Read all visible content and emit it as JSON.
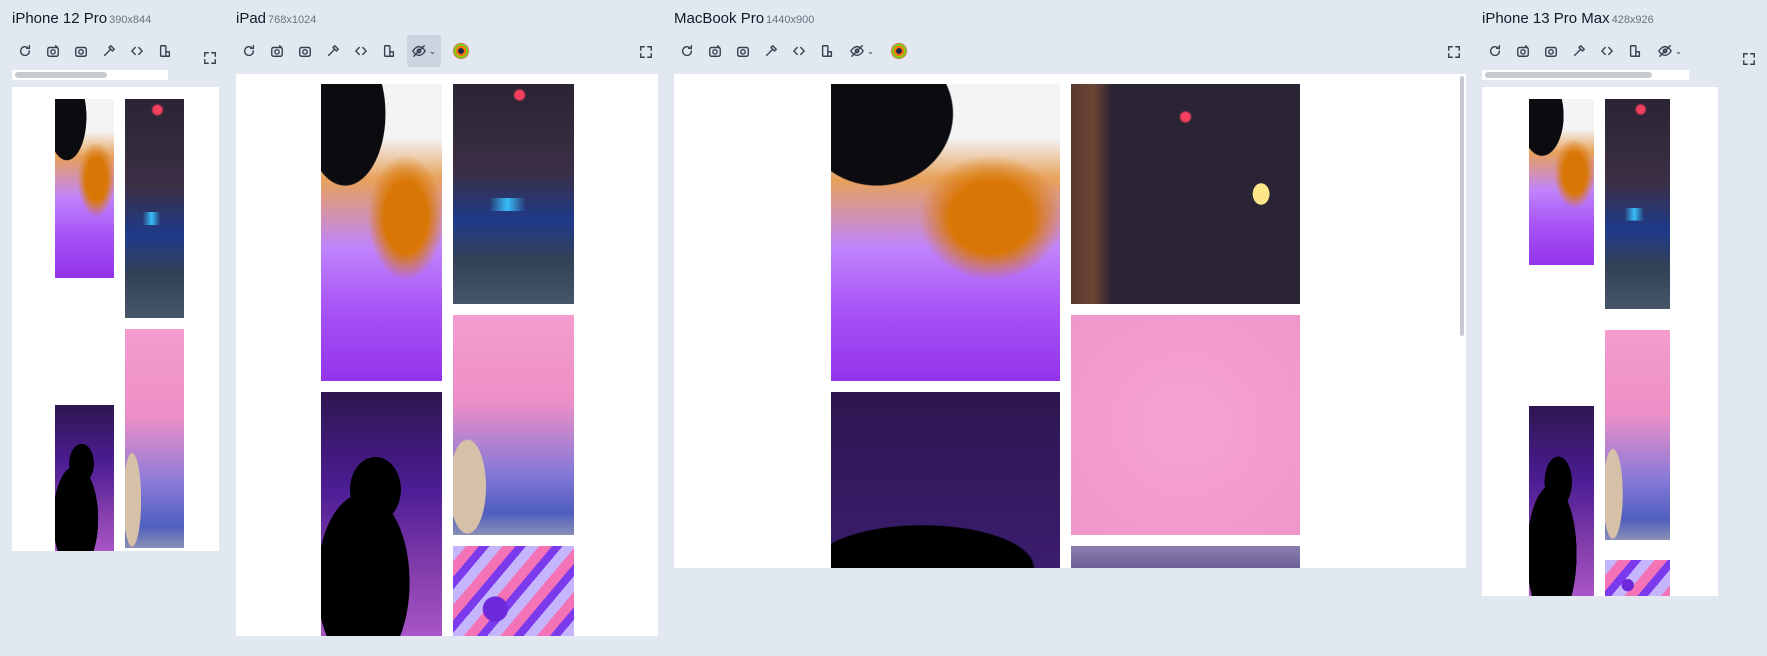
{
  "devices": [
    {
      "name": "iPhone 12 Pro",
      "size": "390x844"
    },
    {
      "name": "iPad",
      "size": "768x1024"
    },
    {
      "name": "MacBook Pro",
      "size": "1440x900"
    },
    {
      "name": "iPhone 13 Pro Max",
      "size": "428x926"
    }
  ],
  "toolbar_icons": [
    "refresh-icon",
    "screenshot-full-icon",
    "camera-icon",
    "eyedropper-icon",
    "code-icon",
    "rotate-device-icon",
    "hide-icon",
    "color-picker-icon",
    "expand-icon"
  ],
  "gallery_images": [
    "face-glitter",
    "neon-alley",
    "pink-wall-figure",
    "phone-silhouette",
    "pink-tube"
  ]
}
